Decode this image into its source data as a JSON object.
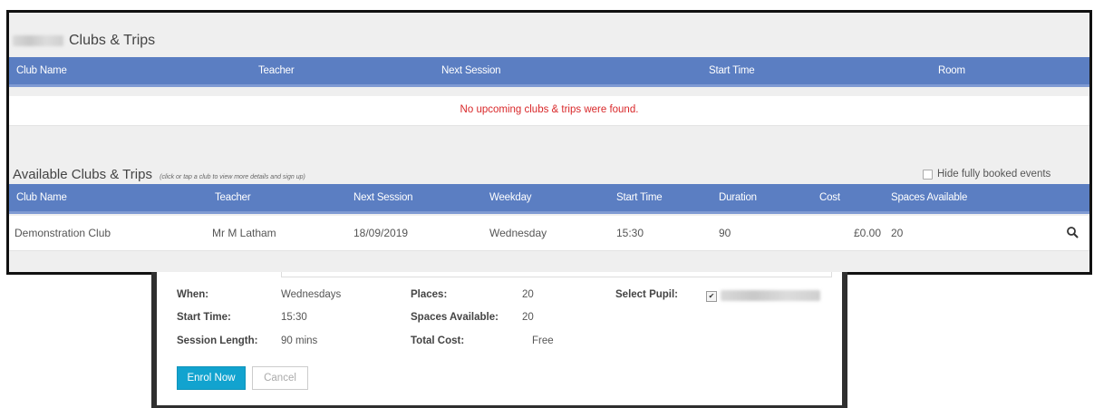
{
  "clubs": {
    "title_suffix": "Clubs & Trips",
    "columns": [
      "Club Name",
      "Teacher",
      "Next Session",
      "Start Time",
      "Room"
    ],
    "empty_message": "No upcoming clubs & trips were found."
  },
  "available": {
    "title": "Available Clubs & Trips",
    "hint": "(click or tap a club to view more details and sign up)",
    "hide_booked_label": "Hide fully booked events",
    "columns": [
      "Club Name",
      "Teacher",
      "Next Session",
      "Weekday",
      "Start Time",
      "Duration",
      "Cost",
      "Spaces Available"
    ],
    "rows": [
      {
        "club_name": "Demonstration Club",
        "teacher": "Mr M Latham",
        "next_session": "18/09/2019",
        "weekday": "Wednesday",
        "start_time": "15:30",
        "duration": "90",
        "cost": "£0.00",
        "spaces": "20",
        "icon": "search-icon"
      }
    ]
  },
  "modal": {
    "when_label": "When:",
    "when_value": "Wednesdays",
    "start_label": "Start Time:",
    "start_value": "15:30",
    "length_label": "Session Length:",
    "length_value": "90 mins",
    "places_label": "Places:",
    "places_value": "20",
    "spaces_label": "Spaces Available:",
    "spaces_value": "20",
    "cost_label": "Total Cost:",
    "cost_value": "Free",
    "pupil_label": "Select Pupil:",
    "pupil_checked": "✔",
    "enrol_label": "Enrol Now",
    "cancel_label": "Cancel"
  },
  "colors": {
    "header_bg": "#5b7ec2",
    "empty_text": "#d9282a",
    "enrol_bg": "#12a3cf"
  }
}
